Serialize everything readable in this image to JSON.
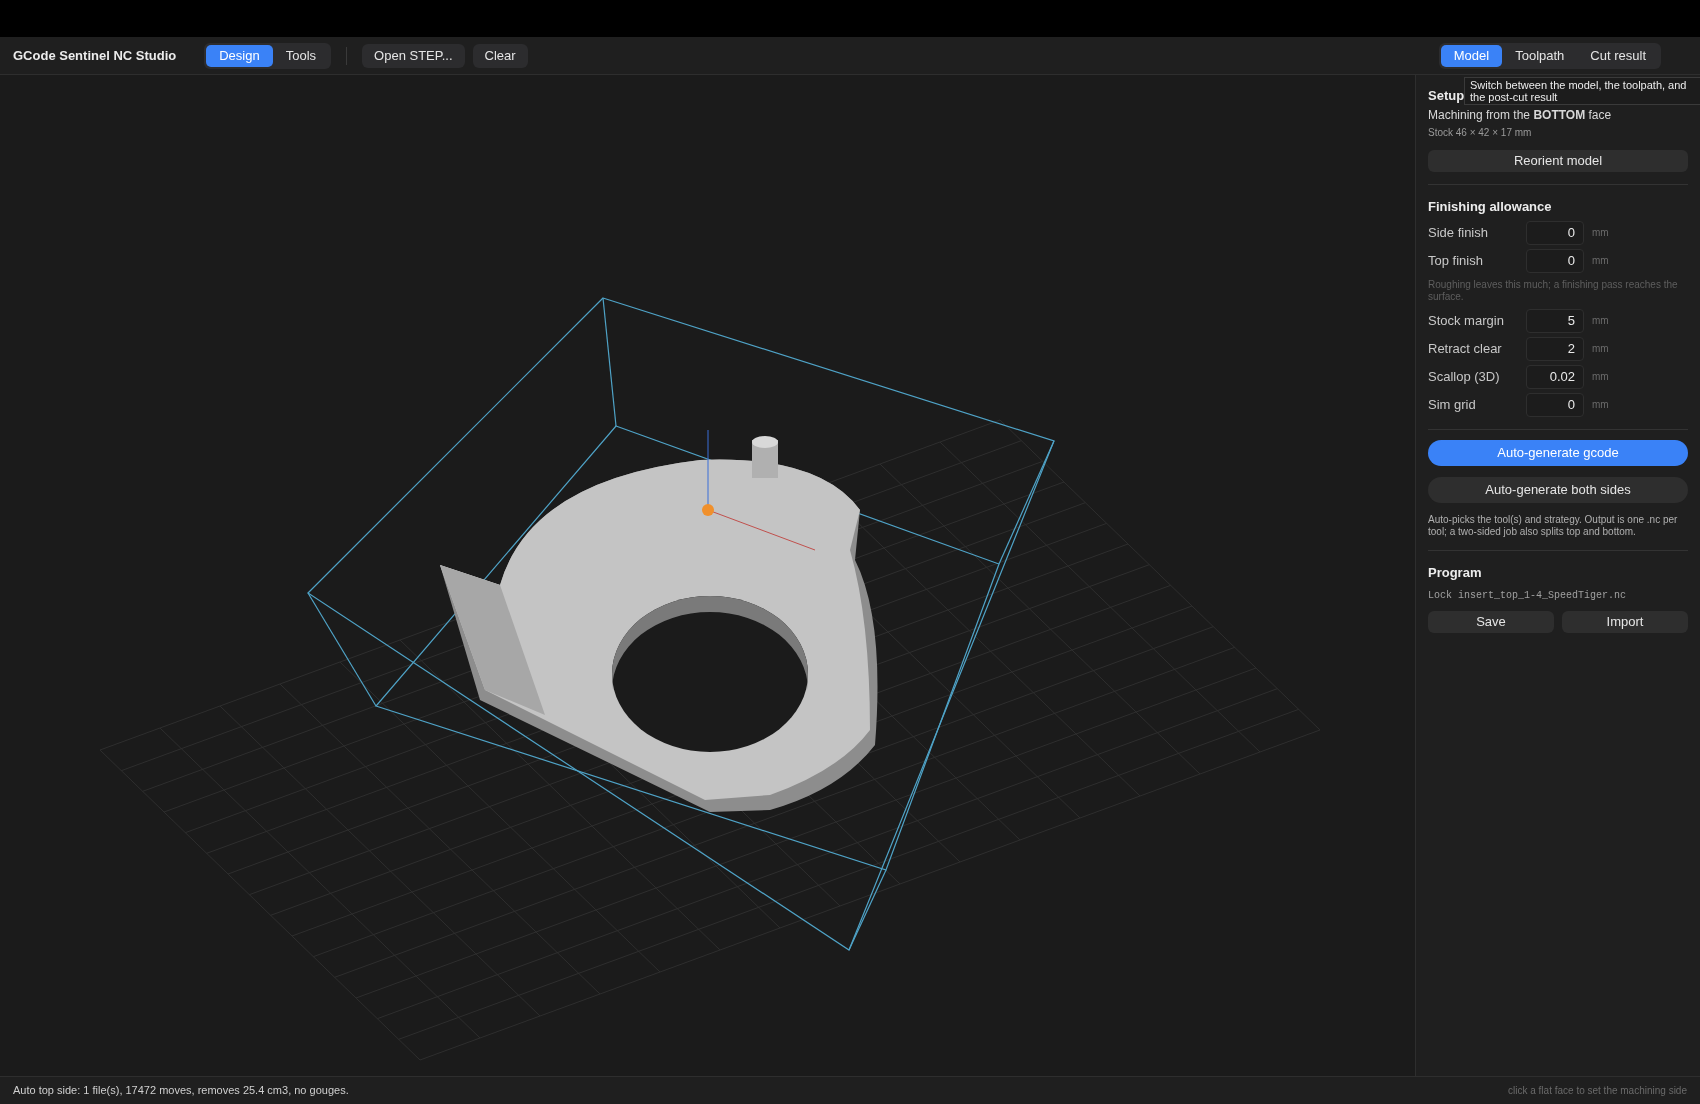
{
  "app": {
    "title": "GCode Sentinel NC Studio"
  },
  "mode_tabs": [
    {
      "label": "Design",
      "selected": true
    },
    {
      "label": "Tools",
      "selected": false
    }
  ],
  "toolbar_buttons": [
    "Open STEP...",
    "Clear"
  ],
  "view_tabs": [
    {
      "label": "Model",
      "selected": true
    },
    {
      "label": "Toolpath",
      "selected": false
    },
    {
      "label": "Cut result",
      "selected": false
    }
  ],
  "tooltip": "Switch between the model, the toolpath, and the post-cut result",
  "setup": {
    "heading": "Setup",
    "machining": "Machining from the **BOTTOM** face",
    "stock": "Stock 46 × 42 × 17 mm",
    "button": "Reorient model"
  },
  "finishing": {
    "heading": "Finishing allowance",
    "fields": [
      {
        "label": "Side finish",
        "value": "0",
        "unit": "mm"
      },
      {
        "label": "Top finish",
        "value": "0",
        "unit": "mm"
      }
    ],
    "note": "Roughing leaves this much; a finishing pass reaches the surface.",
    "more_fields": [
      {
        "label": "Stock margin",
        "value": "5",
        "unit": "mm"
      },
      {
        "label": "Retract clear",
        "value": "2",
        "unit": "mm"
      },
      {
        "label": "Scallop (3D)",
        "value": "0.02",
        "unit": "mm"
      },
      {
        "label": "Sim grid",
        "value": "0",
        "unit": "mm"
      }
    ]
  },
  "actions": [
    {
      "label": "Auto-generate gcode",
      "kind": "primary"
    },
    {
      "label": "Auto-generate both sides",
      "kind": "secondary"
    }
  ],
  "actions_note": "Auto-picks the tool(s) and strategy. Output is one .nc per tool; a two-sided job also splits top and bottom.",
  "program": {
    "heading": "Program",
    "file": "Lock insert_top_1-4_SpeedTiger.nc",
    "buttons": [
      "Save",
      "Import"
    ]
  },
  "status_bar": {
    "message": "Auto top side: 1 file(s), 17472 moves, removes 25.4 cm3, no gouges.",
    "hint": "click a flat face to set the machining side"
  }
}
